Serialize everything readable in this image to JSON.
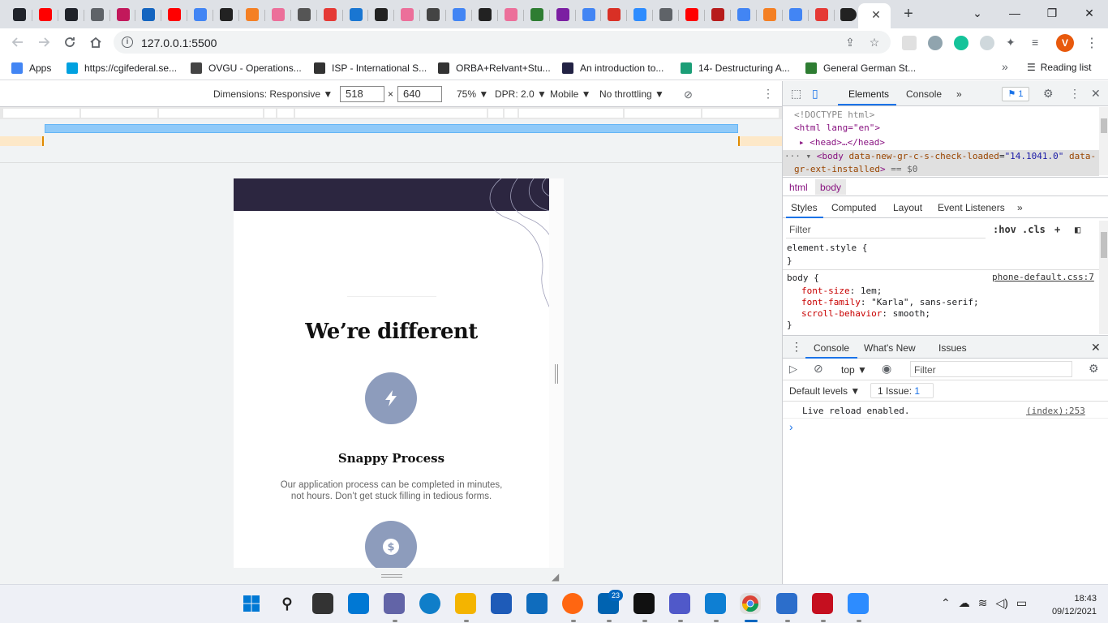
{
  "browser": {
    "tabs": [
      {
        "icon": "react-icon",
        "color": "#20232a"
      },
      {
        "icon": "youtube-icon",
        "color": "#ff0000"
      },
      {
        "icon": "react-icon",
        "color": "#20232a"
      },
      {
        "icon": "globe-icon",
        "color": "#5f6368"
      },
      {
        "icon": "m-logo-icon",
        "color": "#c2185b"
      },
      {
        "icon": "s-logo-icon",
        "color": "#1565c0"
      },
      {
        "icon": "youtube-icon",
        "color": "#ff0000"
      },
      {
        "icon": "google-icon",
        "color": "#4285f4"
      },
      {
        "icon": "eh-icon",
        "color": "#222222"
      },
      {
        "icon": "stackoverflow-icon",
        "color": "#f48024"
      },
      {
        "icon": "pink-square-icon",
        "color": "#ec6f9a"
      },
      {
        "icon": "cube-icon",
        "color": "#555555"
      },
      {
        "icon": "figure-icon",
        "color": "#e53935"
      },
      {
        "icon": "info-f-icon",
        "color": "#1976d2"
      },
      {
        "icon": "slash-icon",
        "color": "#222222"
      },
      {
        "icon": "pink-square-icon",
        "color": "#ec6f9a"
      },
      {
        "icon": "github-alt-icon",
        "color": "#444444"
      },
      {
        "icon": "google-icon",
        "color": "#4285f4"
      },
      {
        "icon": "slash-icon",
        "color": "#222222"
      },
      {
        "icon": "pink-square-icon",
        "color": "#ec6f9a"
      },
      {
        "icon": "w-logo-icon",
        "color": "#2e7d32"
      },
      {
        "icon": "c-logo-icon",
        "color": "#7b1fa2"
      },
      {
        "icon": "google-icon",
        "color": "#4285f4"
      },
      {
        "icon": "gmail-icon",
        "color": "#d93025"
      },
      {
        "icon": "zoom-icon",
        "color": "#2d8cff"
      },
      {
        "icon": "globe-icon",
        "color": "#5f6368"
      },
      {
        "icon": "youtube-icon",
        "color": "#ff0000"
      },
      {
        "icon": "dots-icon",
        "color": "#b71c1c"
      },
      {
        "icon": "google-icon",
        "color": "#4285f4"
      },
      {
        "icon": "stackoverflow-icon",
        "color": "#f48024"
      },
      {
        "icon": "google-icon",
        "color": "#4285f4"
      },
      {
        "icon": "n-logo-icon",
        "color": "#e53935"
      },
      {
        "icon": "github-icon",
        "color": "#222222"
      }
    ],
    "new_tab_symbol": "+",
    "tab_close_symbol": "✕",
    "window_controls": {
      "tab_search": "⌄",
      "minimize": "—",
      "maximize": "❐",
      "close": "✕"
    },
    "url": "127.0.0.1:5500",
    "profile_initial": "V",
    "bookmarks": [
      {
        "label": "Apps",
        "icon": "apps-grid-icon",
        "color": "#4285f4"
      },
      {
        "label": "https://cgifederal.se...",
        "icon": "cloud-icon",
        "color": "#00a1e0"
      },
      {
        "label": "OVGU - Operations...",
        "icon": "gear-icon",
        "color": "#444444"
      },
      {
        "label": "ISP - International S...",
        "icon": "person-icon",
        "color": "#333333"
      },
      {
        "label": "ORBA+Relvant+Stu...",
        "icon": "doc-icon",
        "color": "#333333"
      },
      {
        "label": "An introduction to...",
        "icon": "a-logo-icon",
        "color": "#222244"
      },
      {
        "label": "14- Destructuring A...",
        "icon": "t-logo-icon",
        "color": "#1b9e77"
      },
      {
        "label": "General German St...",
        "icon": "grid-icon",
        "color": "#2e7d32"
      }
    ],
    "bookmarks_more": "»",
    "reading_list": "Reading list"
  },
  "device_toolbar": {
    "dimensions_label": "Dimensions: Responsive ▼",
    "width": "518",
    "times": "×",
    "height": "640",
    "zoom": "75% ▼",
    "dpr": "DPR: 2.0 ▼",
    "mode": "Mobile ▼",
    "throttle": "No throttling ▼"
  },
  "page": {
    "heading": "We’re different",
    "feature_title": "Snappy Process",
    "feature_desc_line1": "Our application process can be completed in minutes,",
    "feature_desc_line2": "not hours. Don’t get stuck filling in tedious forms.",
    "colors": {
      "header": "#2c2640",
      "icon_bg": "#8d9cbc"
    }
  },
  "devtools": {
    "tabs": [
      "Elements",
      "Console"
    ],
    "more": "»",
    "issues_count": "1",
    "dom": {
      "doctype": "<!DOCTYPE html>",
      "html_open": "<html lang=\"en\">",
      "head": "<head>…</head>",
      "body_tag": "<body",
      "body_attr1_name": "data-new-gr-c-s-check-loaded",
      "body_attr1_value": "\"14.1041.0\"",
      "body_attr2_name": "data-",
      "body_attr2_cont": "gr-ext-installed",
      "body_suffix": "== $0"
    },
    "breadcrumbs": [
      "html",
      "body"
    ],
    "styles_tabs": [
      "Styles",
      "Computed",
      "Layout",
      "Event Listeners"
    ],
    "styles_more": "»",
    "filter_placeholder": "Filter",
    "hov": ":hov",
    "cls": ".cls",
    "rules": {
      "element_style": "element.style {",
      "close": "}",
      "body_selector": "body {",
      "source": "phone-default.css:7",
      "decl1_prop": "font-size",
      "decl1_val": "1em;",
      "decl2_prop": "font-family",
      "decl2_val": "\"Karla\", sans-serif;",
      "decl3_prop": "scroll-behavior",
      "decl3_val": "smooth;"
    },
    "drawer_tabs": [
      "Console",
      "What's New",
      "Issues"
    ],
    "console": {
      "context": "top ▼",
      "filter_placeholder": "Filter",
      "levels": "Default levels ▼",
      "issue_chip": "1 Issue:",
      "issue_chip_count": "1",
      "message": "Live reload enabled.",
      "message_source": "(index):253",
      "prompt": "›"
    }
  },
  "taskbar": {
    "badge": "23",
    "time": "18:43",
    "date": "09/12/2021"
  }
}
